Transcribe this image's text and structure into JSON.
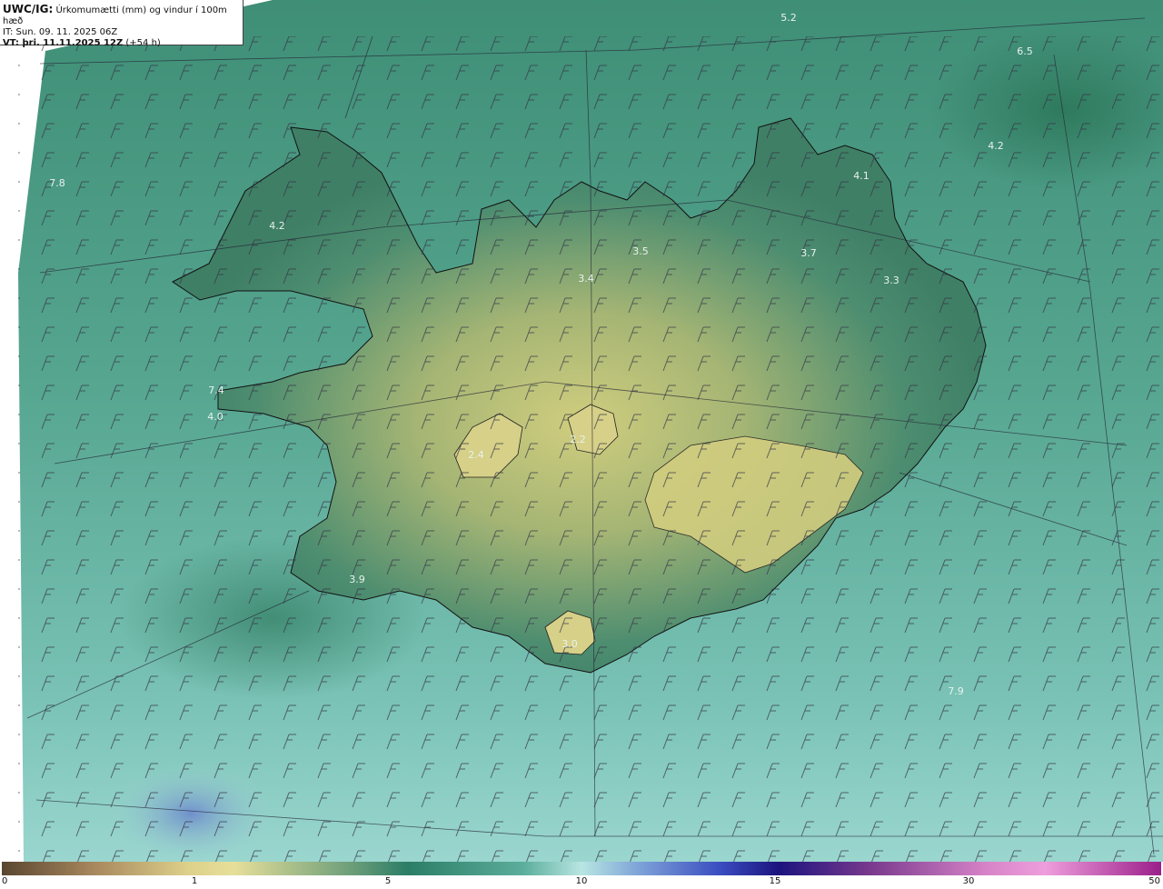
{
  "header": {
    "line1_bold": "UWC/IG:",
    "line1_text": " Úrkomumætti (mm) og vindur í 100m hæð",
    "line2": "IT: Sun. 09. 11. 2025 06Z",
    "line3_bold": "VT: þri. 11.11.2025 12Z",
    "line3_text": " (+54 h)"
  },
  "map": {
    "labels": [
      "5.2",
      "6.5",
      "4.2",
      "4.1",
      "3.7",
      "3.3",
      "3.5",
      "3.4",
      "4.2",
      "7.8",
      "7.4",
      "4.0",
      "2.4",
      "2.2",
      "3.9",
      "3.0",
      "7.9"
    ],
    "icons": [
      "wind-barb-icon"
    ],
    "colors": {
      "ocean_light": "#7fc7bb",
      "ocean_mid": "#4b9e88",
      "land_dark": "#3a7a62",
      "land_yellow": "#cbc97a",
      "coast": "#111111"
    }
  },
  "colorbar": {
    "ticks": [
      "0",
      "1",
      "5",
      "10",
      "15",
      "30",
      "50"
    ]
  }
}
